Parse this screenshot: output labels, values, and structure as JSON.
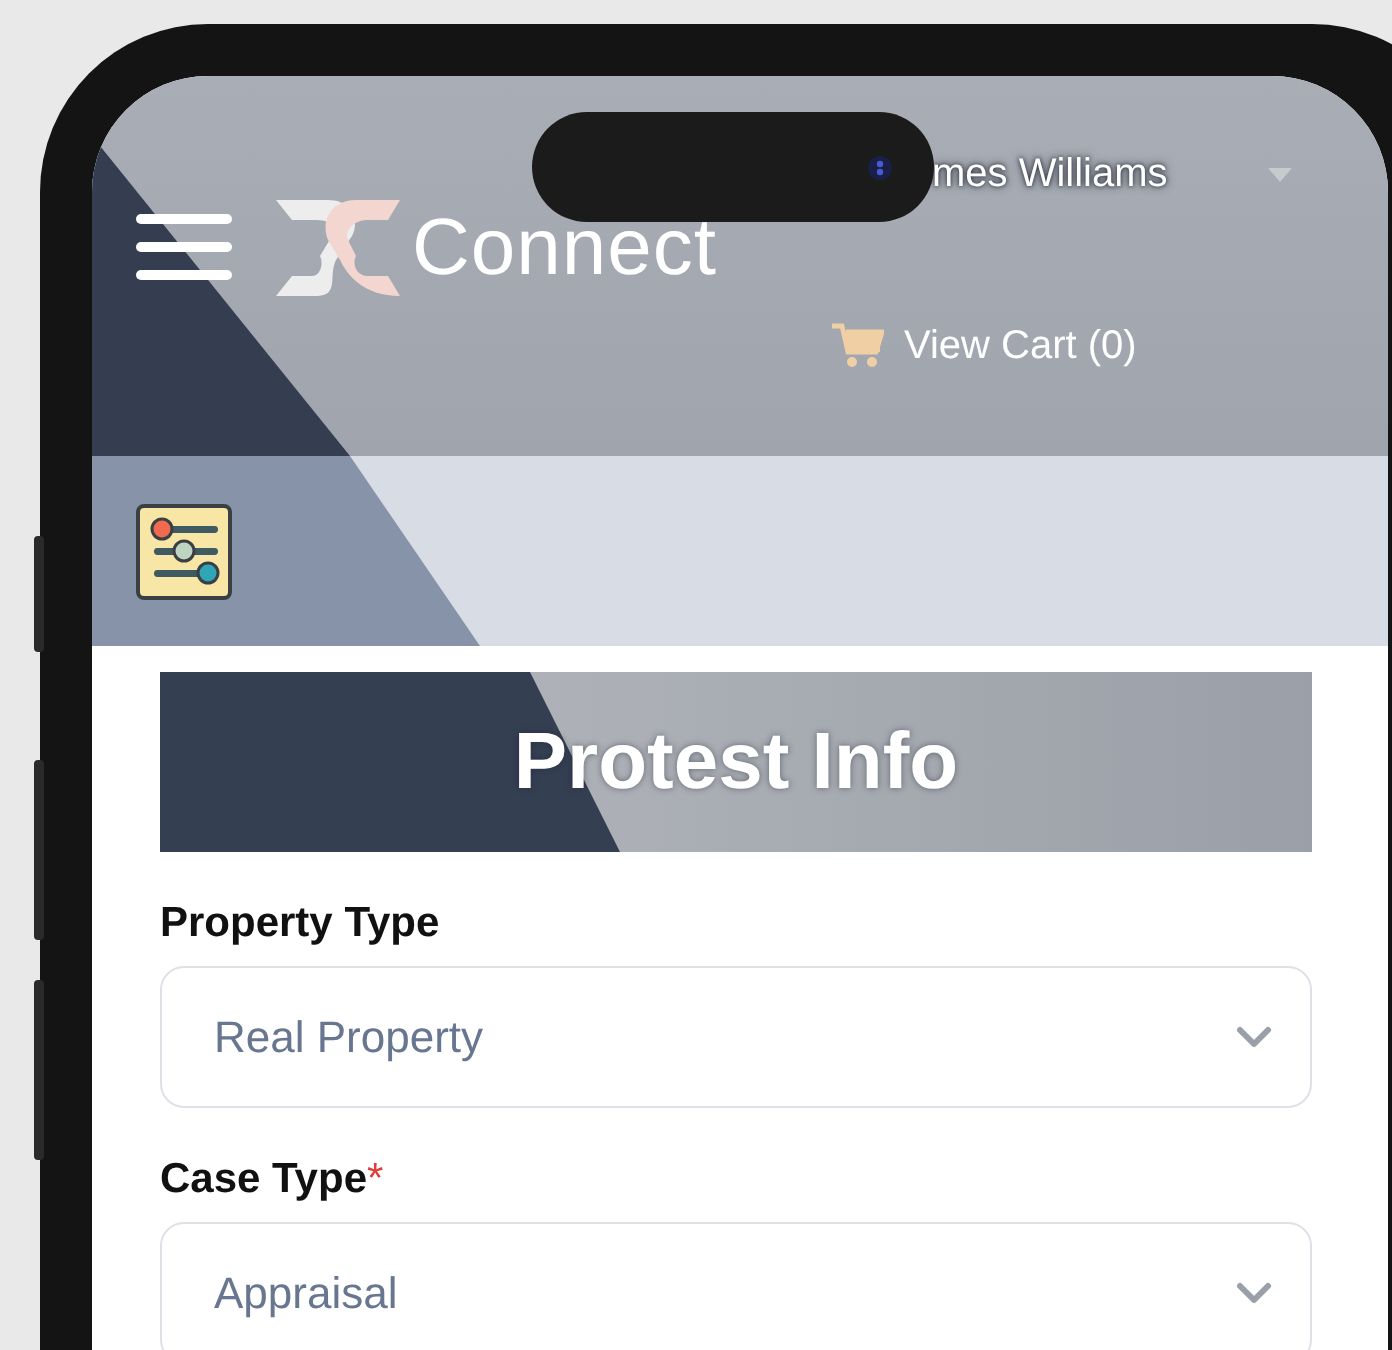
{
  "header": {
    "logo_text": "Connect",
    "user_name": "mes Williams",
    "cart_label": "View Cart (0)"
  },
  "banner": {
    "title": "Protest Info"
  },
  "required_mark": "*",
  "fields": [
    {
      "label": "Property Type",
      "required": false,
      "value": "Real Property"
    },
    {
      "label": "Case Type",
      "required": true,
      "value": "Appraisal"
    }
  ]
}
